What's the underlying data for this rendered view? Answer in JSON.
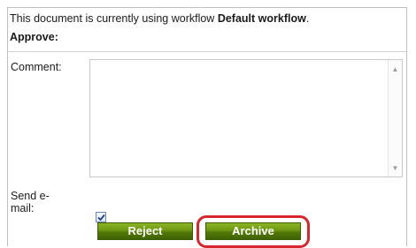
{
  "workflow_info": {
    "prefix": "This document is currently using workflow ",
    "workflow_name": "Default workflow",
    "suffix": "."
  },
  "section_title": "Approve:",
  "form": {
    "comment_label": "Comment:",
    "comment_value": "",
    "send_email_label": "Send e-mail:",
    "send_email_checked": true
  },
  "buttons": {
    "reject_label": "Reject",
    "archive_label": "Archive"
  },
  "icons": {
    "scroll_up": "scroll-up-arrow-icon",
    "scroll_down": "scroll-down-arrow-icon",
    "checkmark": "checkmark-icon"
  },
  "colors": {
    "button_green": "#5f8a0c",
    "highlight_red": "#d7262e",
    "checkbox_border": "#6d86b6"
  }
}
